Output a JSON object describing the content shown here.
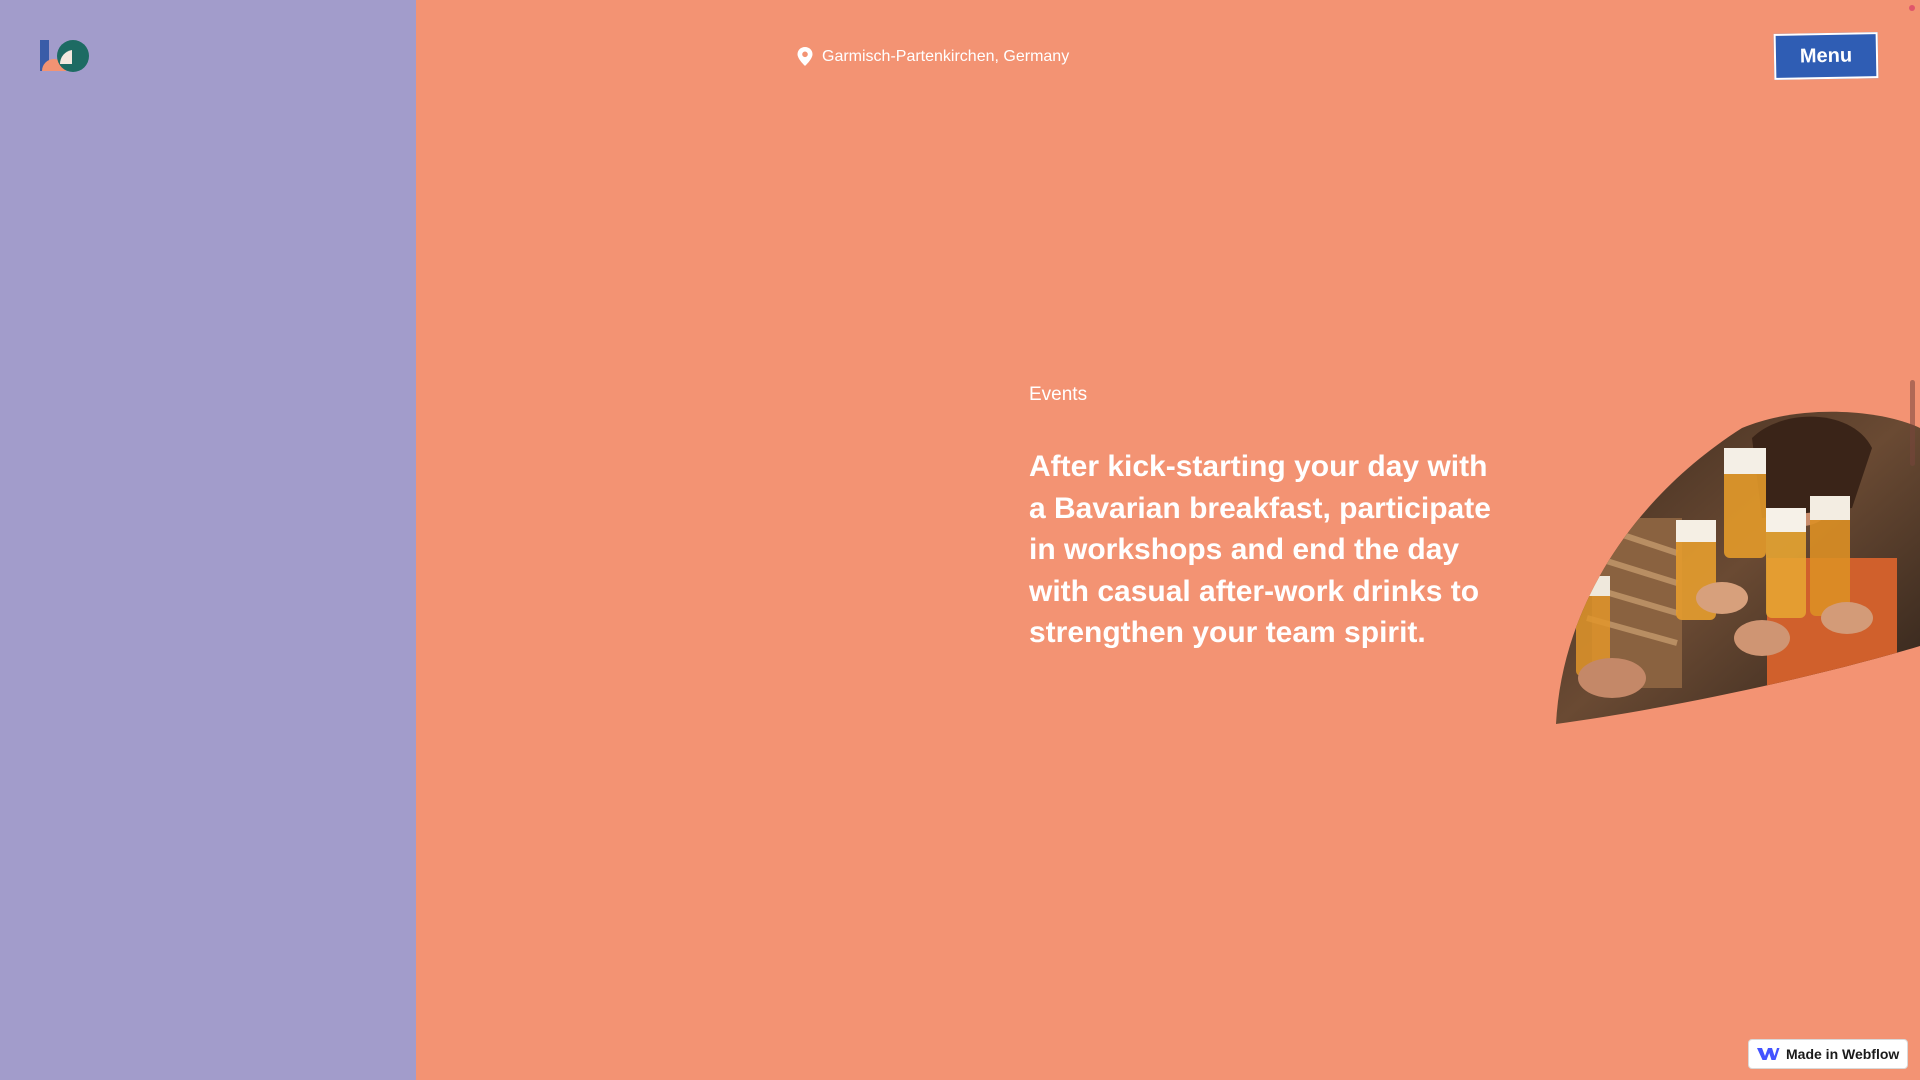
{
  "header": {
    "location": "Garmisch-Partenkirchen, Germany",
    "menu_label": "Menu"
  },
  "content": {
    "section_label": "Events",
    "headline": "After kick-starting your day with a Bavarian breakfast, participate in workshops and end the day with casual after-work drinks to strengthen your team spirit."
  },
  "badge": {
    "label": "Made in Webflow"
  },
  "icons": {
    "logo": "brand-logo-icon",
    "location": "map-pin-icon",
    "badge": "webflow-logo-icon"
  },
  "colors": {
    "page_background": "#f39373",
    "left_panel": "#a29ccb",
    "menu_button": "#2f5db4",
    "text": "#ffffff"
  }
}
